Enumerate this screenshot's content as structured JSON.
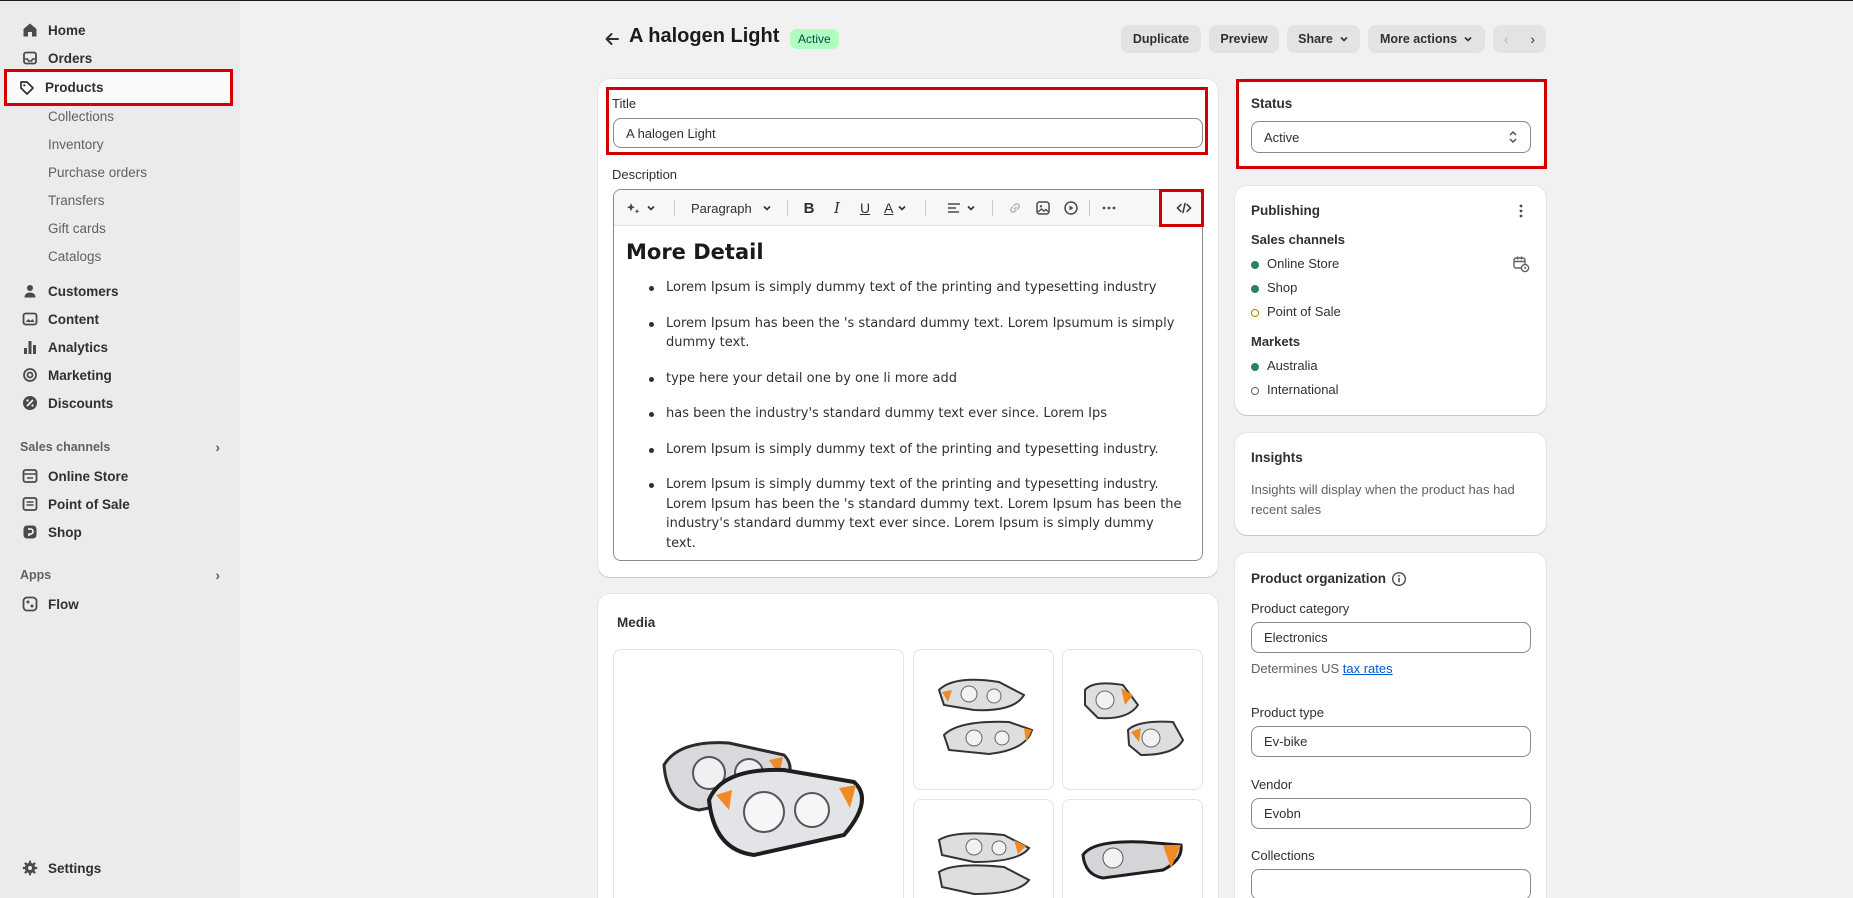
{
  "nav": {
    "home": "Home",
    "orders": "Orders",
    "products": "Products",
    "product_sub": [
      "Collections",
      "Inventory",
      "Purchase orders",
      "Transfers",
      "Gift cards",
      "Catalogs"
    ],
    "customers": "Customers",
    "content": "Content",
    "analytics": "Analytics",
    "marketing": "Marketing",
    "discounts": "Discounts",
    "sales_channels_label": "Sales channels",
    "channels": [
      "Online Store",
      "Point of Sale",
      "Shop"
    ],
    "apps_label": "Apps",
    "apps": [
      "Flow"
    ],
    "settings": "Settings"
  },
  "header": {
    "title": "A halogen Light",
    "status_badge": "Active",
    "duplicate": "Duplicate",
    "preview": "Preview",
    "share": "Share",
    "more_actions": "More actions"
  },
  "product": {
    "title_label": "Title",
    "title_value": "A halogen Light",
    "description_label": "Description",
    "format_select": "Paragraph",
    "content_heading": "More Detail",
    "bullets": [
      "Lorem Ipsum is simply dummy text of the printing and typesetting industry",
      "Lorem Ipsum has been the 's standard dummy text. Lorem Ipsumum is simply dummy text.",
      "type here your detail one by one li more add",
      "has been the industry's standard dummy text ever since. Lorem Ips",
      "Lorem Ipsum is simply dummy text of the printing and typesetting industry.",
      "Lorem Ipsum is simply dummy text of the printing and typesetting industry. Lorem Ipsum has been the 's standard dummy text. Lorem Ipsum has been the industry's standard dummy text ever since. Lorem Ipsum is simply dummy text."
    ]
  },
  "media": {
    "label": "Media"
  },
  "status_card": {
    "label": "Status",
    "value": "Active"
  },
  "publishing": {
    "label": "Publishing",
    "sales_channels_label": "Sales channels",
    "channels": [
      "Online Store",
      "Shop",
      "Point of Sale"
    ],
    "markets_label": "Markets",
    "markets": [
      "Australia",
      "International"
    ]
  },
  "insights": {
    "label": "Insights",
    "text": "Insights will display when the product has had recent sales"
  },
  "organization": {
    "label": "Product organization",
    "category_label": "Product category",
    "category_value": "Electronics",
    "tax_note_prefix": "Determines US ",
    "tax_link": "tax rates",
    "type_label": "Product type",
    "type_value": "Ev-bike",
    "vendor_label": "Vendor",
    "vendor_value": "Evobn",
    "collections_label": "Collections",
    "collections_value": ""
  },
  "colors": {
    "highlight": "#d40000",
    "active_badge_bg": "#affebf",
    "channel_green": "#29845a",
    "channel_pending": "#b28400",
    "link": "#005bd3"
  }
}
